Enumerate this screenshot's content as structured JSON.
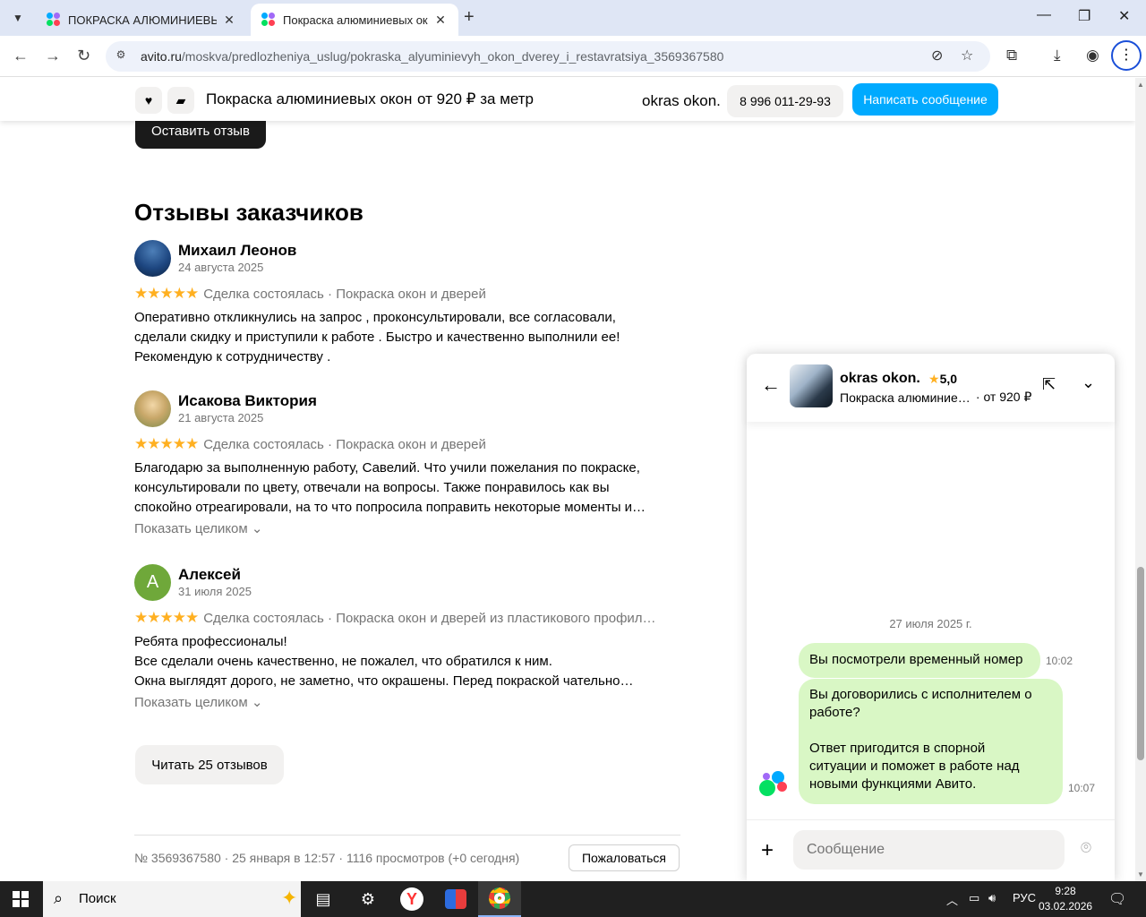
{
  "browser": {
    "tabs": [
      {
        "title": "ПОКРАСКА АЛЮМИНИЕВЫХ ДВЕРЕЙ"
      },
      {
        "title": "Покраска алюминиевых окон"
      }
    ],
    "url_host": "avito.ru",
    "url_path": "/moskva/predlozheniya_uslug/pokraska_alyuminievyh_okon_dverey_i_restavratsiya_3569367580"
  },
  "sticky": {
    "title": "Покраска алюминиевых окон",
    "price": "от 920 ₽ за метр",
    "seller": "okras okon.",
    "phone": "8 996 011-29-93",
    "write_label": "Написать сообщение"
  },
  "leave_review_label": "Оставить отзыв",
  "reviews_title": "Отзывы заказчиков",
  "reviews": [
    {
      "name": "Михаил Леонов",
      "date": "24 августа 2025",
      "stars": "★★★★★",
      "meta": "Сделка состоялась · Покраска окон и дверей",
      "lines": [
        "Оперативно откликнулись на запрос , проконсультировали, все согласовали,",
        "сделали скидку и приступили к работе . Быстро и качественно выполнили ее!",
        "Рекомендую к сотрудничеству ."
      ]
    },
    {
      "name": "Исакова Виктория",
      "date": "21 августа 2025",
      "stars": "★★★★★",
      "meta": "Сделка состоялась · Покраска окон и дверей",
      "lines": [
        "Благодарю за выполненную работу, Савелий. Что учили пожелания по покраске,",
        "консультировали по цвету, отвечали на вопросы. Также понравилось как вы",
        "спокойно отреагировали, на то что попросила поправить некоторые моменты и…"
      ],
      "show_all": "Показать целиком ⌄"
    },
    {
      "name": "Алексей",
      "initial": "А",
      "date": "31 июля 2025",
      "stars": "★★★★★",
      "meta": "Сделка состоялась · Покраска окон и дверей из пластикового профил…",
      "lines": [
        "Ребята профессионалы!",
        "Все сделали очень качественно, не пожалел, что обратился к ним.",
        "Окна выглядят дорого, не заметно, что окрашены. Перед покраской чательно…"
      ],
      "show_all": "Показать целиком ⌄"
    }
  ],
  "read_reviews_label": "Читать 25 отзывов",
  "footer_info": "№ 3569367580 · 25 января в 12:57 · 1116 просмотров (+0 сегодня)",
  "complain_label": "Пожаловаться",
  "chat": {
    "seller": "okras okon.",
    "rating": "5,0",
    "ad_title": "Покраска алюминиевых окон",
    "ad_price": "· от 920 ₽",
    "date": "27 июля 2025 г.",
    "messages": [
      {
        "text": "Вы посмотрели временный номер",
        "time": "10:02"
      },
      {
        "line1": "Вы договорились с исполнителем о",
        "line2": "работе?",
        "line3": "Ответ пригодится в спорной",
        "line4": "ситуации и поможет в работе над",
        "line5": "новыми функциями Авито.",
        "time": "10:07"
      }
    ],
    "input_placeholder": "Сообщение"
  },
  "taskbar": {
    "search_label": "Поиск",
    "lang": "РУС",
    "time": "9:28",
    "date": "03.02.2026"
  },
  "colors": {
    "accent_blue": "#00aaff",
    "bubble_green": "#d9f7c5",
    "star": "#ffb021"
  }
}
